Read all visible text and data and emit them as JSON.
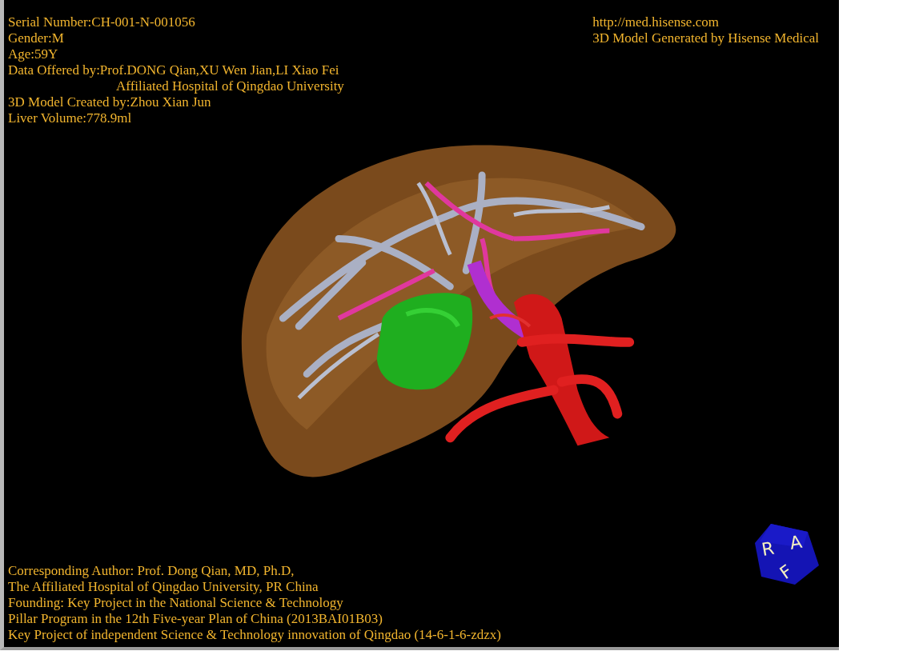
{
  "info_lines": [
    {
      "kind": "line",
      "text": "Serial Number:CH-001-N-001056"
    },
    {
      "kind": "line",
      "text": "Gender:M"
    },
    {
      "kind": "line",
      "text": "Age:59Y"
    },
    {
      "kind": "line",
      "text": "Data Offered by:Prof.DONG Qian,XU Wen Jian,LI Xiao Fei"
    },
    {
      "kind": "continuation",
      "text": "Affiliated Hospital of Qingdao University"
    },
    {
      "kind": "line",
      "text": "3D Model Created by:Zhou Xian Jun"
    },
    {
      "kind": "line",
      "text": "Liver Volume:778.9ml"
    }
  ],
  "credit_lines": [
    "http://med.hisense.com",
    "3D Model Generated by Hisense Medical"
  ],
  "footer_lines": [
    "Corresponding Author: Prof. Dong Qian, MD, Ph.D,",
    "The Affiliated Hospital of Qingdao University, PR China",
    "Founding: Key Project in the National Science & Technology",
    "Pillar Program in the 12th Five-year Plan of China (2013BAI01B03)",
    "Key Project of independent Science & Technology innovation of Qingdao (14-6-1-6-zdzx)"
  ],
  "orientation_cube": {
    "labels": [
      "R",
      "A",
      "F"
    ]
  }
}
